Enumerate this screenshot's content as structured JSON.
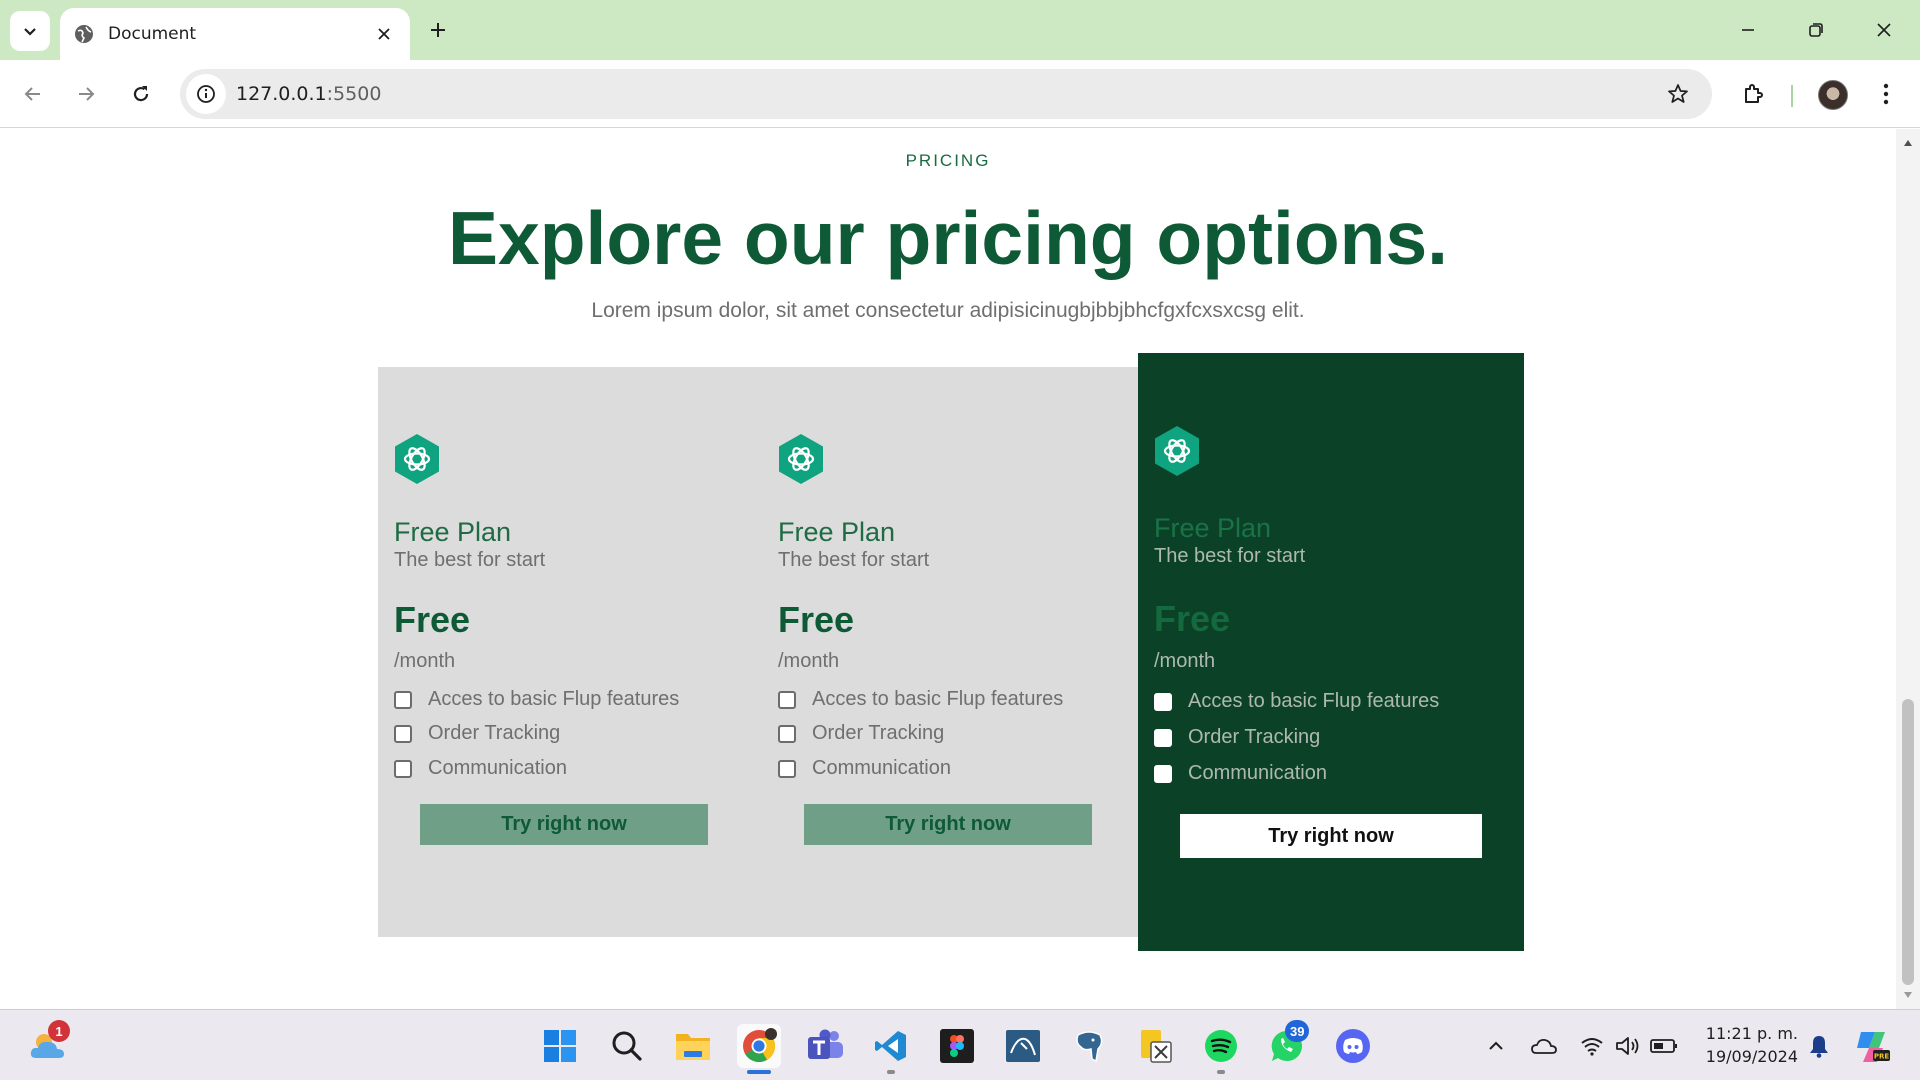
{
  "browser": {
    "tab_title": "Document",
    "url_host": "127.0.0.1",
    "url_port": ":5500",
    "icons": [
      "tab-search-icon",
      "globe-icon",
      "close-icon",
      "plus-icon",
      "minimize-icon",
      "restore-icon",
      "window-close-icon",
      "back-icon",
      "forward-icon",
      "reload-icon",
      "site-info-icon",
      "star-icon",
      "extensions-icon",
      "menu-icon"
    ]
  },
  "page": {
    "eyebrow": "PRICING",
    "headline": "Explore our pricing options.",
    "subtitle": "Lorem ipsum dolor, sit amet consectetur adipisicinugbjbbjbhcfgxfcxsxcsg elit.",
    "plans": [
      {
        "name": "Free Plan",
        "description": "The best for start",
        "price": "Free",
        "period": "/month",
        "features": [
          "Acces to basic Flup features",
          "Order Tracking",
          "Communication"
        ],
        "cta": "Try right now"
      },
      {
        "name": "Free Plan",
        "description": "The best for start",
        "price": "Free",
        "period": "/month",
        "features": [
          "Acces to basic Flup features",
          "Order Tracking",
          "Communication"
        ],
        "cta": "Try right now"
      },
      {
        "name": "Free Plan",
        "description": "The best for start",
        "price": "Free",
        "period": "/month",
        "features": [
          "Acces to basic Flup features",
          "Order Tracking",
          "Communication"
        ],
        "cta": "Try right now"
      }
    ]
  },
  "colors": {
    "brand_green": "#0f5a36",
    "featured_card": "#0b4227",
    "card_gray": "#dcdcdc",
    "button_green": "#6f9f86",
    "logo_teal": "#10a37f",
    "tab_strip": "#cde9c3"
  },
  "taskbar": {
    "weather_badge": "1",
    "whatsapp_badge": "39",
    "time": "11:21 p. m.",
    "date": "19/09/2024",
    "apps": [
      "weather-icon",
      "windows-start-icon",
      "search-icon",
      "file-explorer-icon",
      "chrome-icon",
      "teams-icon",
      "vscode-icon",
      "figma-icon",
      "mysql-workbench-icon",
      "postgresql-icon",
      "xampp-icon",
      "spotify-icon",
      "whatsapp-icon",
      "discord-icon"
    ],
    "tray": [
      "chevron-up-icon",
      "onedrive-icon",
      "wifi-icon",
      "volume-icon",
      "battery-icon",
      "notification-bell-icon",
      "copilot-icon"
    ]
  }
}
